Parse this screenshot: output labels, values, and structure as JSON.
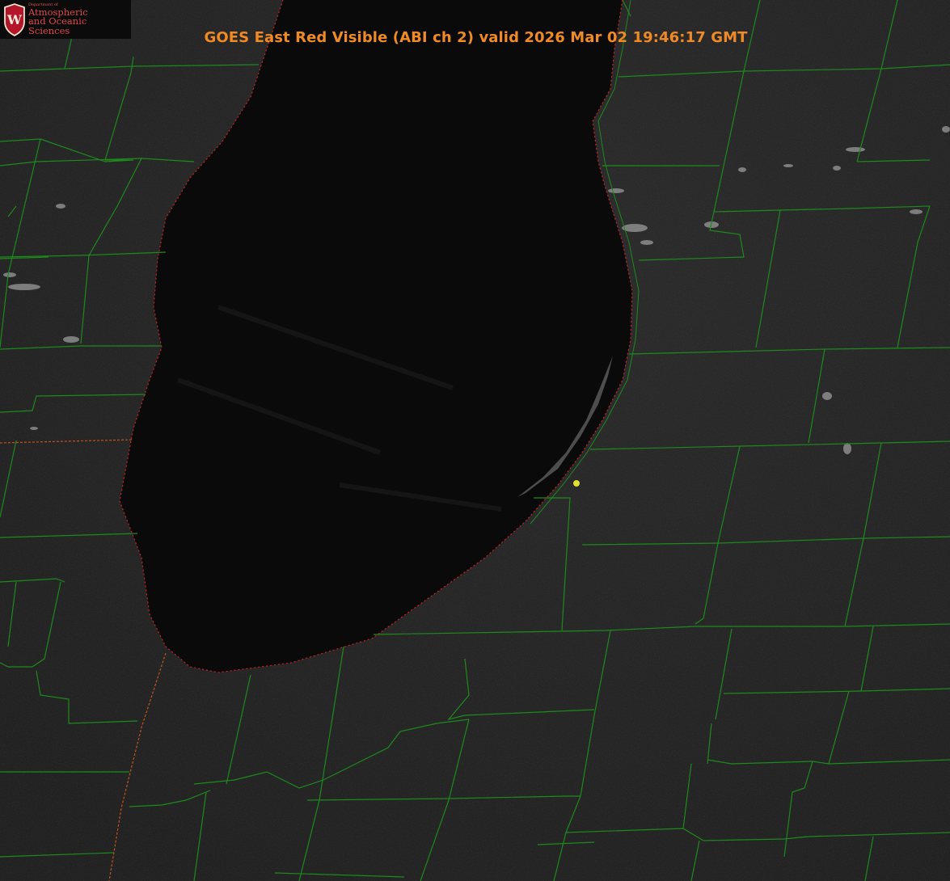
{
  "title": "GOES East Red Visible (ABI ch 2) valid 2026 Mar 02 19:46:17 GMT",
  "logo": {
    "department": "Department of",
    "line1": "Atmospheric",
    "line2": "and Oceanic Sciences",
    "crest_letter": "W"
  },
  "colors": {
    "title": "#f08a24",
    "county_lines": "#1d8a1d",
    "state_line": "#c0541c",
    "shoreline": "#d02020",
    "marker": "#e0e030",
    "land": "#262626",
    "lake": "#0a0a0a",
    "logo_text": "#e0484a",
    "crest": "#b5152b"
  },
  "map": {
    "product": "GOES East Red Visible (ABI ch 2)",
    "water_body": "lake",
    "marker_icon": "location-dot-icon"
  }
}
